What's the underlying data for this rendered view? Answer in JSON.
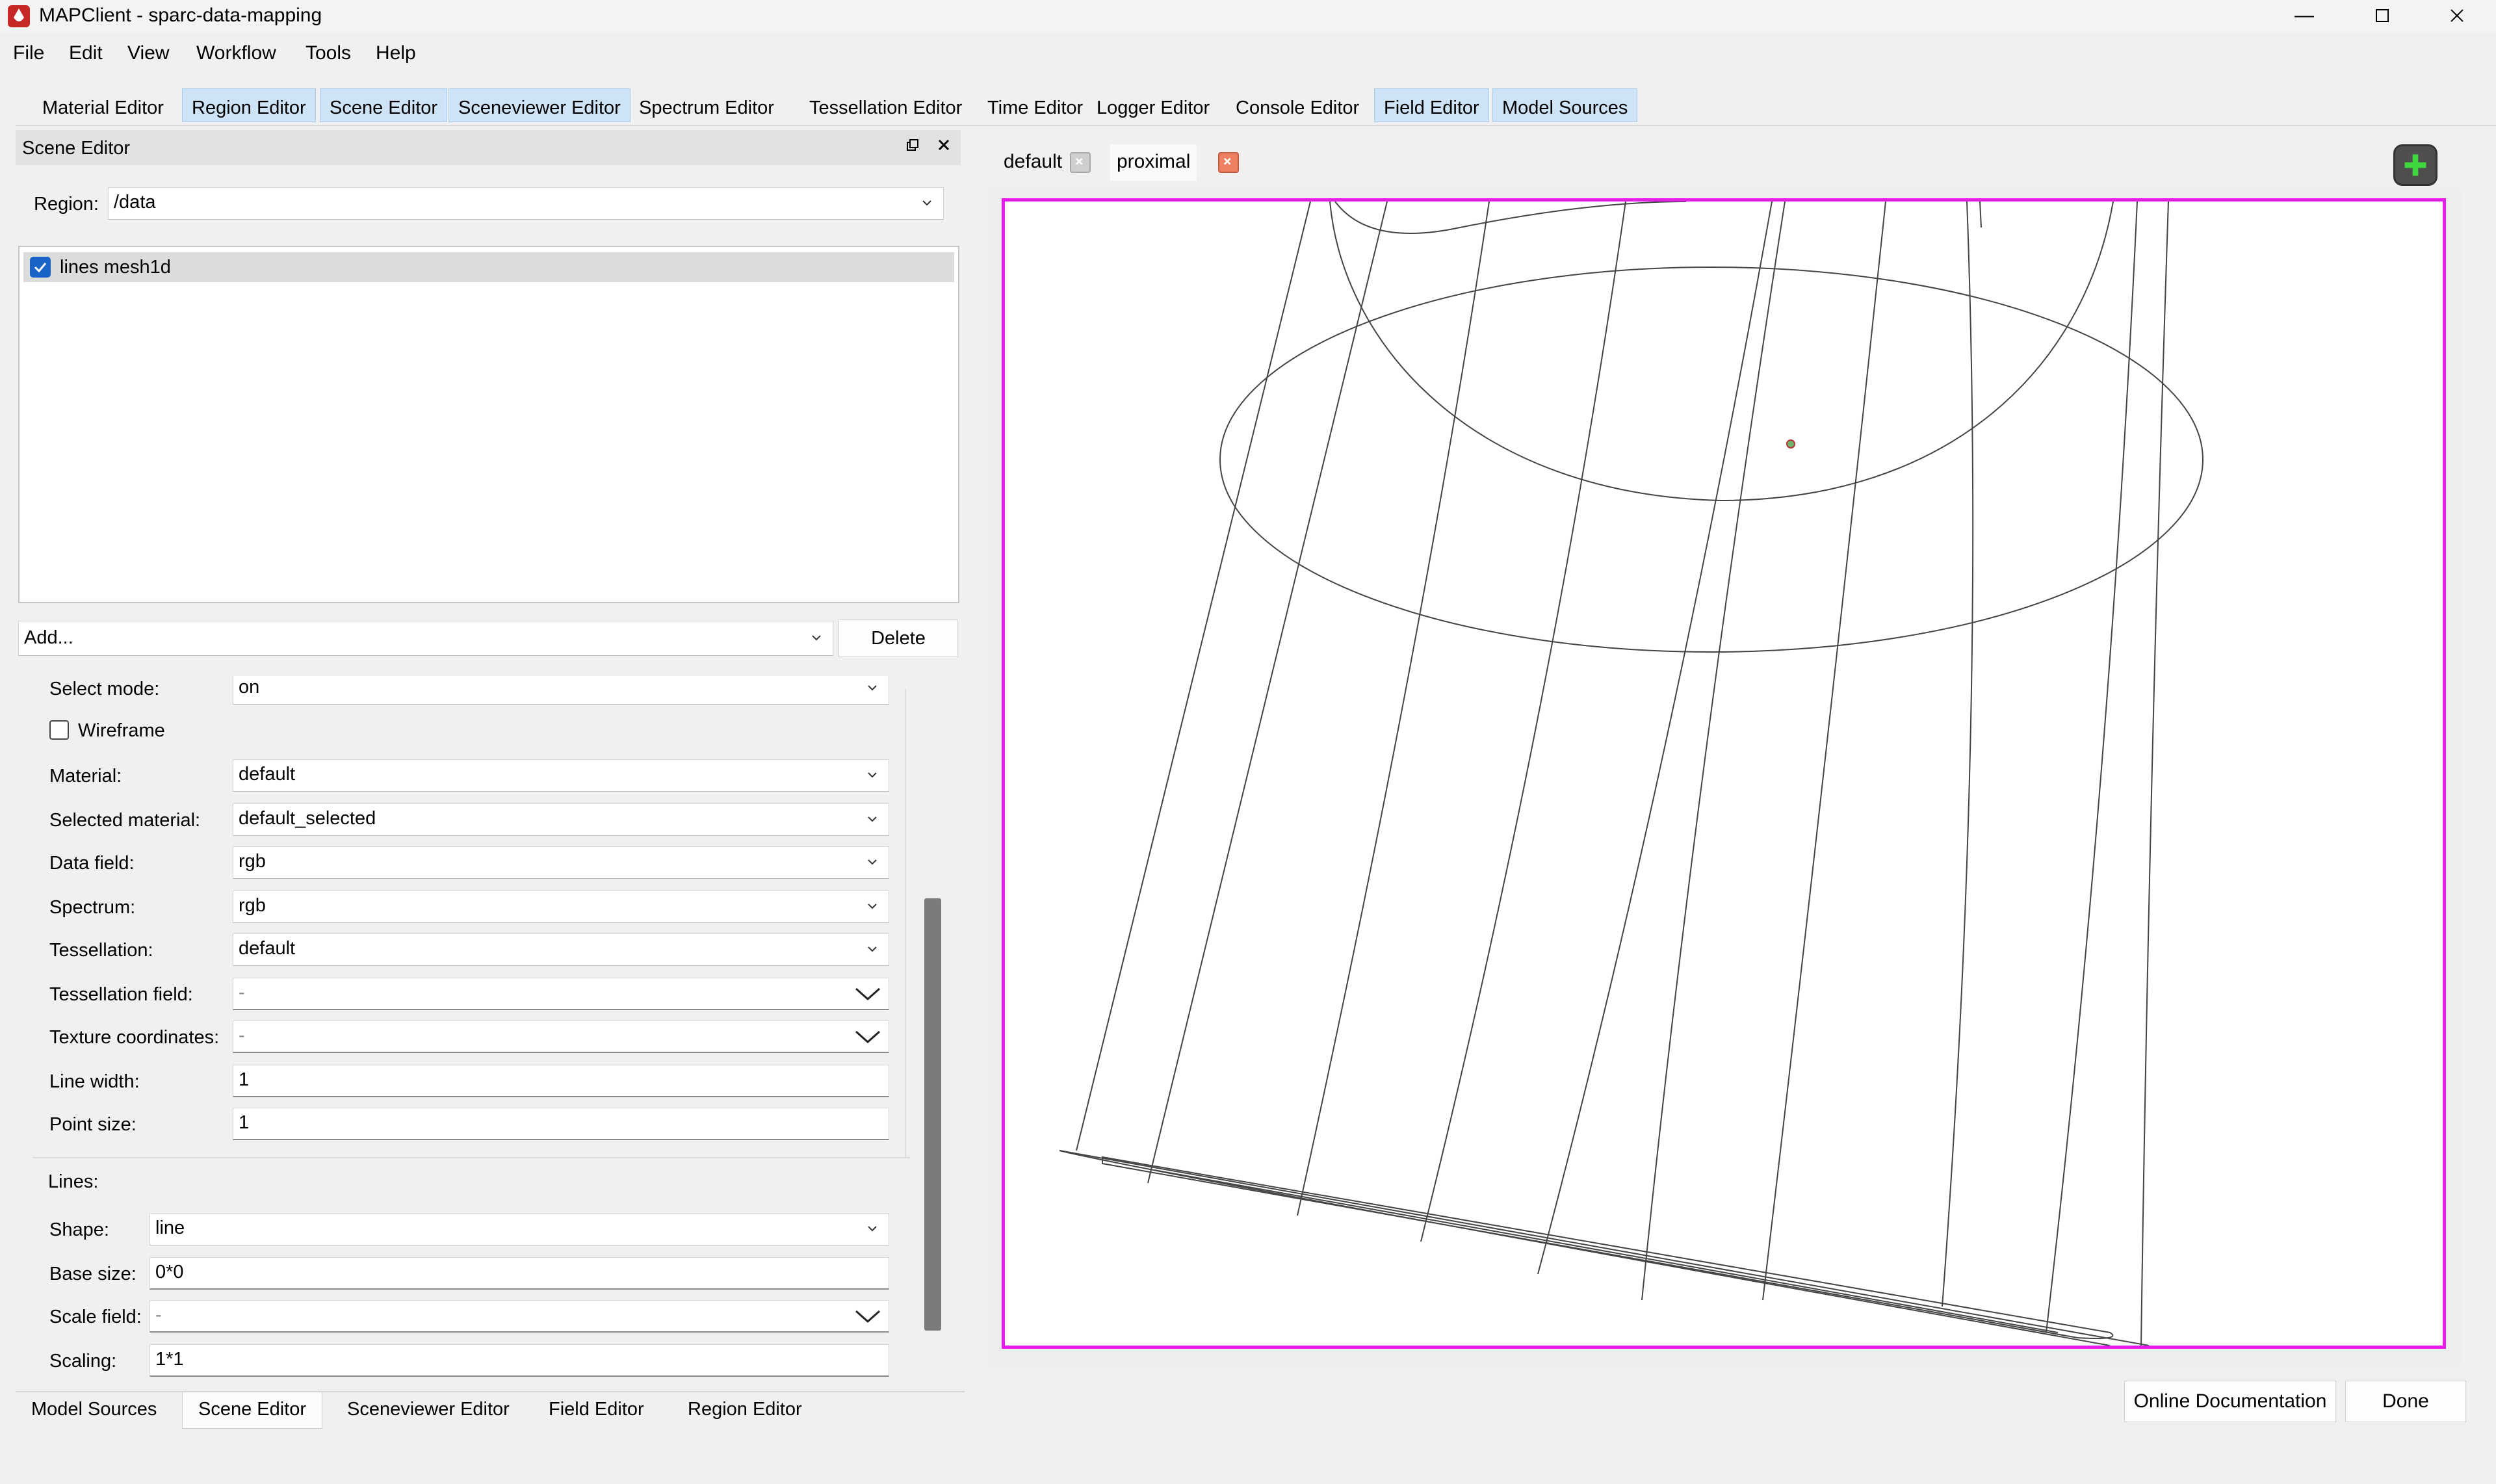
{
  "window": {
    "title": "MAPClient - sparc-data-mapping",
    "controls": [
      "minimize-icon",
      "maximize-icon",
      "close-icon"
    ],
    "accent": "#e81ce8"
  },
  "menubar": {
    "items": [
      "File",
      "Edit",
      "View",
      "Workflow",
      "Tools",
      "Help"
    ]
  },
  "dock_tabs": {
    "items": [
      {
        "label": "Material Editor",
        "highlighted": false
      },
      {
        "label": "Region Editor",
        "highlighted": true
      },
      {
        "label": "Scene Editor",
        "highlighted": true
      },
      {
        "label": "Sceneviewer Editor",
        "highlighted": true
      },
      {
        "label": "Spectrum Editor",
        "highlighted": false
      },
      {
        "label": "Tessellation Editor",
        "highlighted": false
      },
      {
        "label": "Time Editor",
        "highlighted": false
      },
      {
        "label": "Logger Editor",
        "highlighted": false
      },
      {
        "label": "Console Editor",
        "highlighted": false
      },
      {
        "label": "Field Editor",
        "highlighted": true
      },
      {
        "label": "Model Sources",
        "highlighted": true
      }
    ]
  },
  "scene_editor": {
    "title": "Scene Editor",
    "region_label": "Region:",
    "region_value": "/data",
    "graphics": [
      {
        "label": "lines mesh1d",
        "checked": true
      }
    ],
    "add_value": "Add...",
    "delete_label": "Delete",
    "properties": {
      "select_mode": {
        "label": "Select mode:",
        "value": "on"
      },
      "wireframe": {
        "label": "Wireframe",
        "checked": false
      },
      "material": {
        "label": "Material:",
        "value": "default"
      },
      "selected_material": {
        "label": "Selected material:",
        "value": "default_selected"
      },
      "data_field": {
        "label": "Data field:",
        "value": "rgb"
      },
      "spectrum": {
        "label": "Spectrum:",
        "value": "rgb"
      },
      "tessellation": {
        "label": "Tessellation:",
        "value": "default"
      },
      "tessellation_field": {
        "label": "Tessellation field:",
        "value": "-"
      },
      "texture_coordinates": {
        "label": "Texture coordinates:",
        "value": "-"
      },
      "line_width": {
        "label": "Line width:",
        "value": "1"
      },
      "point_size": {
        "label": "Point size:",
        "value": "1"
      }
    },
    "lines_group": {
      "title": "Lines:",
      "shape": {
        "label": "Shape:",
        "value": "line"
      },
      "base_size": {
        "label": "Base size:",
        "value": "0*0"
      },
      "scale_field": {
        "label": "Scale field:",
        "value": "-"
      },
      "scaling": {
        "label": "Scaling:",
        "value": "1*1"
      }
    }
  },
  "bottom_tabs": {
    "items": [
      "Model Sources",
      "Scene Editor",
      "Sceneviewer Editor",
      "Field Editor",
      "Region Editor"
    ],
    "active": "Scene Editor"
  },
  "view_tabs": {
    "items": [
      {
        "label": "default",
        "active": false
      },
      {
        "label": "proximal",
        "active": true
      }
    ]
  },
  "footer": {
    "docs_label": "Online Documentation",
    "done_label": "Done"
  }
}
